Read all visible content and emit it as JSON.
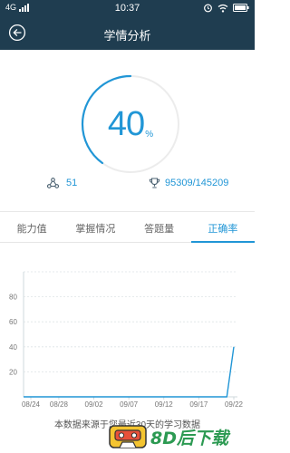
{
  "status_bar": {
    "network": "4G",
    "time": "10:37",
    "icons": [
      "signal-icon",
      "alarm-icon",
      "wifi-icon",
      "battery-icon"
    ]
  },
  "header": {
    "title": "学情分析",
    "back_icon": "back-arrow-icon"
  },
  "summary": {
    "percent": 40,
    "percent_value": "40",
    "percent_unit": "%",
    "stat_left": {
      "icon": "share-icon",
      "value": "51"
    },
    "stat_right": {
      "icon": "trophy-icon",
      "value": "95309/145209"
    }
  },
  "tabs": [
    {
      "label": "能力值",
      "active": false
    },
    {
      "label": "掌握情况",
      "active": false
    },
    {
      "label": "答题量",
      "active": false
    },
    {
      "label": "正确率",
      "active": true
    }
  ],
  "chart_data": {
    "type": "line",
    "x_ticks": [
      "08/24",
      "08/28",
      "09/02",
      "09/07",
      "09/12",
      "09/17",
      "09/22"
    ],
    "y_ticks": [
      20,
      40,
      60,
      80
    ],
    "ylim": [
      0,
      100
    ],
    "series": [
      {
        "values": [
          0,
          0,
          0,
          0,
          0,
          0,
          0,
          40
        ]
      }
    ],
    "x_points": [
      "08/24",
      "08/28",
      "09/02",
      "09/07",
      "09/12",
      "09/17",
      "09/21",
      "09/22"
    ],
    "grid": true
  },
  "footnote": "本数据来源于您最近30天的学习数据",
  "watermark": {
    "text": "8D后下载",
    "logo": "cassette-logo"
  },
  "colors": {
    "header_bg": "#1f3d50",
    "accent": "#2196d6",
    "ring_track": "#ececec"
  }
}
